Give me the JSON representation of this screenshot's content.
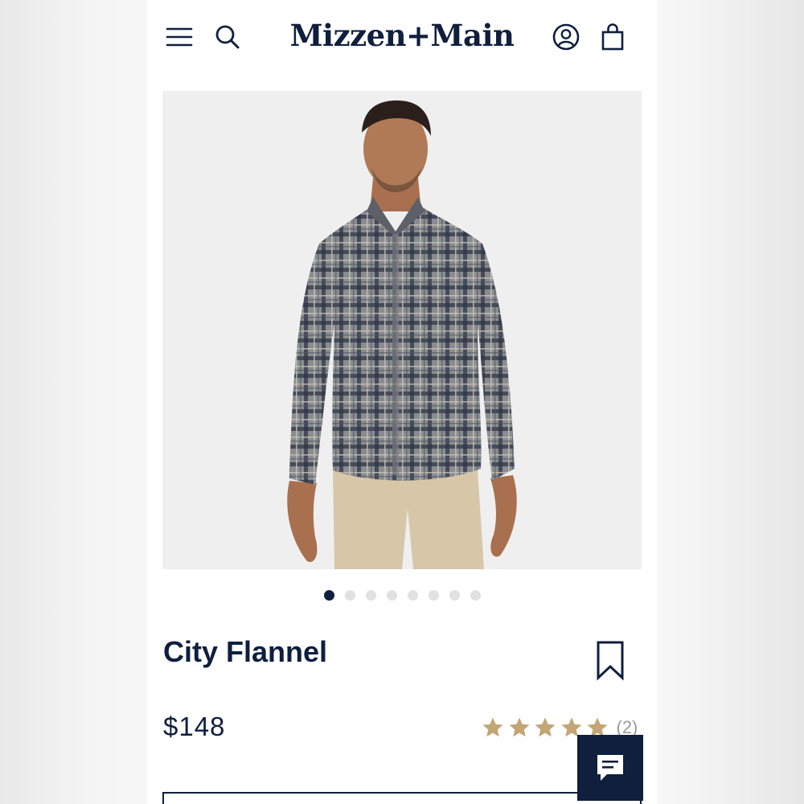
{
  "header": {
    "brand": "Mizzen+Main",
    "icons": [
      "menu-icon",
      "search-icon",
      "account-icon",
      "shopping-bag-icon"
    ]
  },
  "gallery": {
    "image_count": 8,
    "active_index": 0
  },
  "product": {
    "title": "City Flannel",
    "price": "$148",
    "rating": 5,
    "rating_max": 5,
    "review_count": "(2)"
  },
  "colors": {
    "brand_navy": "#0f1f3d",
    "star_gold": "#c4a574",
    "dot_inactive": "#e1e1e1"
  }
}
